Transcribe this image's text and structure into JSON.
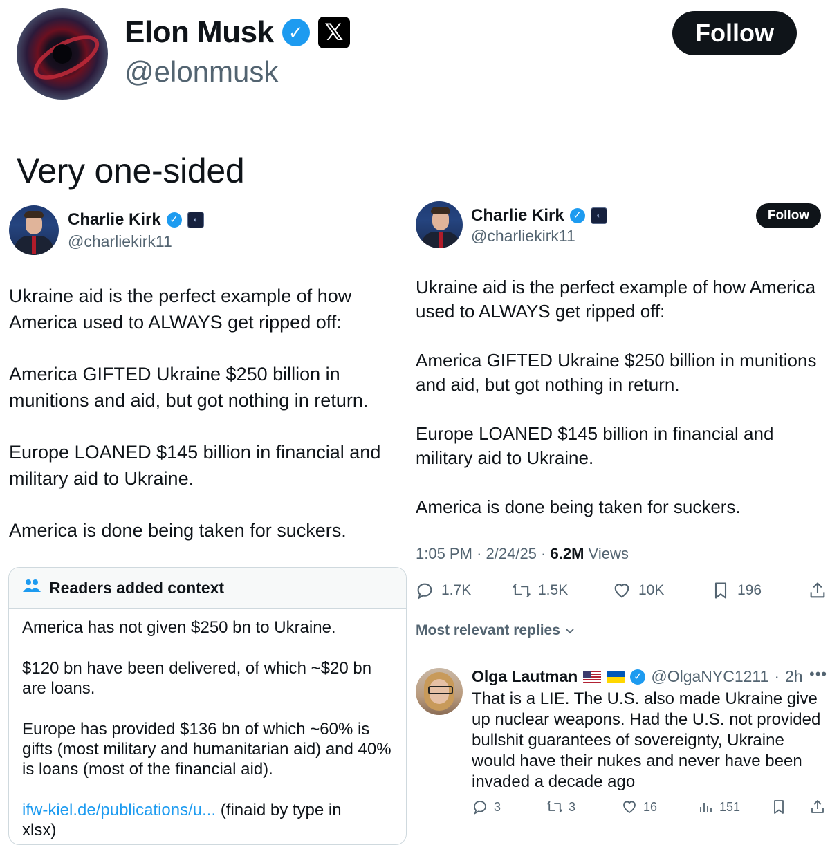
{
  "header": {
    "name": "Elon Musk",
    "handle": "@elonmusk",
    "follow_label": "Follow",
    "verified_icon": "verified-badge-icon",
    "affiliate_icon": "x-logo-icon"
  },
  "quote": {
    "text": "Very one-sided"
  },
  "left_post": {
    "name": "Charlie Kirk",
    "handle": "@charliekirk11",
    "paragraphs": [
      "Ukraine aid is the perfect example of how America used to ALWAYS get ripped off:",
      "America GIFTED Ukraine $250 billion in munitions and aid, but got nothing in return.",
      "Europe LOANED $145 billion in financial and military aid to Ukraine.",
      "America is done being taken for suckers."
    ],
    "lines": [
      "Ukraine aid is the perfect example of how",
      "America used to ALWAYS get ripped off:",
      "America GIFTED Ukraine $250 billion in",
      "munitions and aid, but got nothing in return.",
      "Europe LOANED $145 billion in financial and",
      "military aid to Ukraine.",
      "America is done being taken for suckers."
    ]
  },
  "community_note": {
    "title": "Readers added context",
    "paragraphs": [
      "America has not given $250 bn to Ukraine.",
      "$120 bn have been delivered, of which ~$20 bn are loans.",
      "Europe has provided $136 bn of which ~60% is gifts (most  military and humanitarian aid) and 40% is loans (most of the financial aid)."
    ],
    "link_text": "ifw-kiel.de/publications/u...",
    "link_suffix": " (finaid by type in",
    "cut_line": "xlsx)"
  },
  "right_post": {
    "name": "Charlie Kirk",
    "handle": "@charliekirk11",
    "follow_label": "Follow",
    "lines": [
      "Ukraine aid is the perfect example of how America",
      "used to ALWAYS get ripped off:",
      "America GIFTED Ukraine $250 billion in munitions",
      "and aid, but got nothing in return.",
      "Europe LOANED $145 billion in financial and",
      "military aid to Ukraine.",
      "America is done being taken for suckers."
    ],
    "time": "1:05 PM",
    "date": "2/24/25",
    "views_count": "6.2M",
    "views_label": "Views",
    "stats": {
      "replies": "1.7K",
      "reposts": "1.5K",
      "likes": "10K",
      "bookmarks": "196"
    },
    "replies_filter": "Most relevant replies"
  },
  "reply": {
    "name": "Olga Lautman",
    "flags": [
      "us-flag-icon",
      "ukraine-flag-icon"
    ],
    "handle": "@OlgaNYC1211",
    "age": "2h",
    "text": "That is a LIE. The U.S. also made Ukraine give up nuclear weapons. Had the U.S. not provided bullshit guarantees of sovereignty, Ukraine would have their nukes and never have been invaded a decade ago",
    "stats": {
      "replies": "3",
      "reposts": "3",
      "likes": "16",
      "views": "151"
    }
  },
  "colors": {
    "text": "#0f1419",
    "muted": "#536471",
    "accent": "#1d9bf0",
    "border": "#cfd9de",
    "button": "#0f1419"
  }
}
